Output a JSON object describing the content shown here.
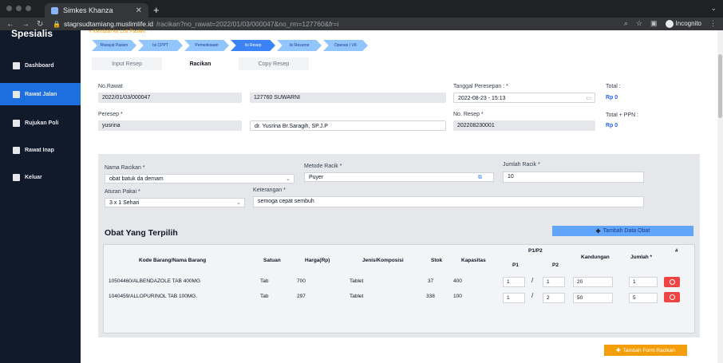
{
  "browser": {
    "tab_title": "Simkes Khanza",
    "url_host": "stagrsudtamiang.muslimlife.id",
    "url_path": "/racikan?no_rawat=2022/01/03/000047&no_rm=127760&fr=i",
    "incognito_label": "Incognito"
  },
  "sidebar": {
    "brand": "Spesialis",
    "items": [
      {
        "label": "Dashboard"
      },
      {
        "label": "Rawat Jalan"
      },
      {
        "label": "Rujukan Poli"
      },
      {
        "label": "Rawat Inap"
      },
      {
        "label": "Keluar"
      }
    ]
  },
  "main": {
    "back_link": "Kembali ke List Pasien",
    "steps": [
      "Riwayat Pasien",
      "Isi CPPT",
      "Pemeriksaan",
      "Isi Resep",
      "Isi Resume",
      "Operasi / VK"
    ],
    "tabs": [
      "Input Resep",
      "Racikan",
      "Copy Resep"
    ],
    "form": {
      "no_rawat_label": "No.Rawat",
      "no_rawat": "2022/01/03/000047",
      "no_rm": "127760 SUWARNI",
      "tgl_label": "Tanggal Peresepan : *",
      "tgl": "2022-08-23 - 15:13",
      "total_label": "Total :",
      "total": "Rp 0",
      "peresep_label": "Peresep *",
      "peresep": "yusrina",
      "dokter": "dr. Yusrina Br.Saragih, SP.J.P",
      "no_resep_label": "No. Resep *",
      "no_resep": "202208230001",
      "total_ppn_label": "Total + PPN :",
      "total_ppn": "Rp 0"
    },
    "racikan": {
      "nama_label": "Nama Racikan *",
      "nama": "obat batuk da demam",
      "metode_label": "Metode Racik *",
      "metode": "Puyer",
      "jumlah_label": "Jumlah Racik *",
      "jumlah": "10",
      "aturan_label": "Aturan Pakai *",
      "aturan": "3 x 1 Sehari",
      "ket_label": "Keterangan *",
      "ket": "semoga cepat sembuh",
      "section_title": "Obat Yang Terpilih",
      "add_obat_button": "Tambah Data Obat",
      "headers": {
        "kode": "Kode Barang/Nama Barang",
        "satuan": "Satuan",
        "harga": "Harga(Rp)",
        "jenis": "Jenis/Komposisi",
        "stok": "Stok",
        "kapasitas": "Kapasitas",
        "p1p2": "P1/P2",
        "p1": "P1",
        "p2": "P2",
        "kandungan": "Kandungan",
        "jumlah": "Jumlah *",
        "hash": "#"
      },
      "rows": [
        {
          "kode": "10504460/ALBENDAZOLE TAB 400MG",
          "satuan": "Tab",
          "harga": "700",
          "jenis": "Tablet",
          "stok": "37",
          "kapasitas": "400",
          "p1": "1",
          "p2": "1",
          "kandungan": "20",
          "jumlah": "1"
        },
        {
          "kode": "1040459/ALLOPURINOL TAB 100MG.",
          "satuan": "Tab",
          "harga": "297",
          "jenis": "Tablet",
          "stok": "338",
          "kapasitas": "100",
          "p1": "1",
          "p2": "2",
          "kandungan": "50",
          "jumlah": "5"
        }
      ],
      "add_form_button": "Tambah Form Racikan"
    }
  }
}
